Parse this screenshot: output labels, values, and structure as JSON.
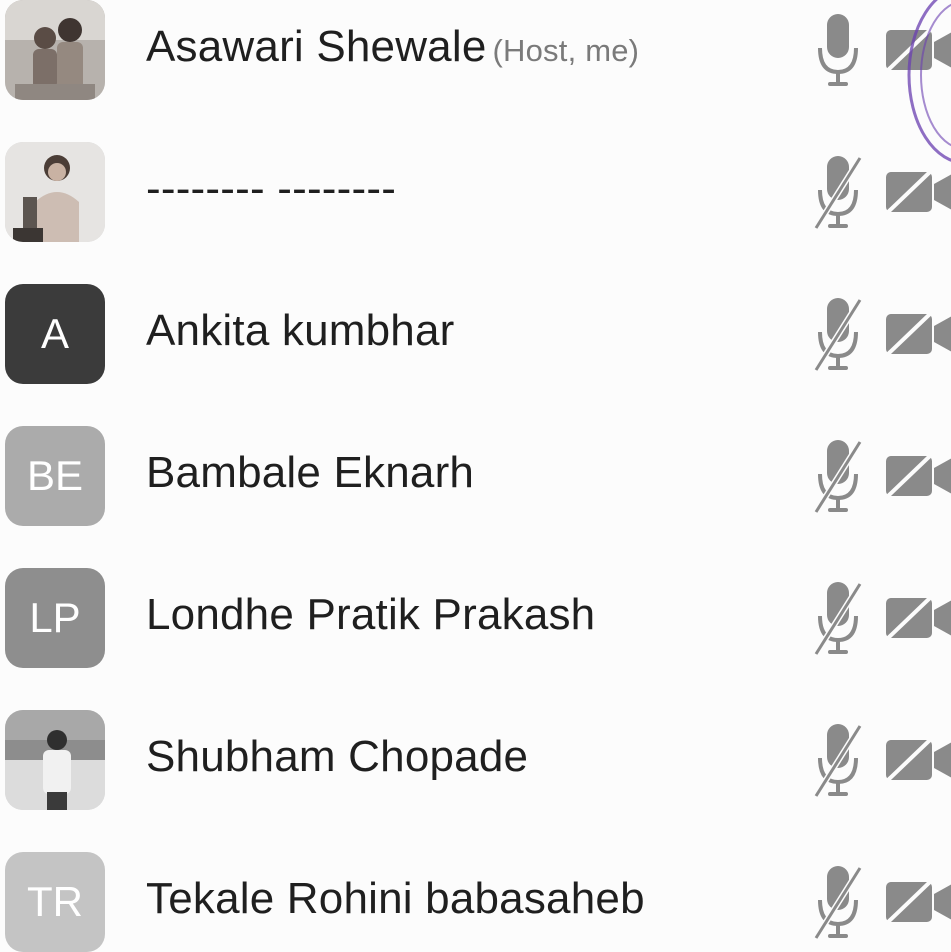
{
  "participants": [
    {
      "name": "Asawari Shewale",
      "role": "(Host, me)",
      "avatar_type": "photo",
      "avatar_initials": "",
      "mic": "on",
      "video": "off"
    },
    {
      "name": "-------- --------",
      "role": "",
      "avatar_type": "photo",
      "avatar_initials": "",
      "mic": "muted",
      "video": "off"
    },
    {
      "name": "Ankita kumbhar",
      "role": "",
      "avatar_type": "initials",
      "avatar_initials": "A",
      "mic": "muted",
      "video": "off"
    },
    {
      "name": "Bambale Eknarh",
      "role": "",
      "avatar_type": "initials",
      "avatar_initials": "BE",
      "mic": "muted",
      "video": "off"
    },
    {
      "name": "Londhe Pratik Prakash",
      "role": "",
      "avatar_type": "initials",
      "avatar_initials": "LP",
      "mic": "muted",
      "video": "off"
    },
    {
      "name": "Shubham Chopade",
      "role": "",
      "avatar_type": "photo",
      "avatar_initials": "",
      "mic": "muted",
      "video": "off"
    },
    {
      "name": "Tekale Rohini babasaheb",
      "role": "",
      "avatar_type": "initials",
      "avatar_initials": "TR",
      "mic": "muted",
      "video": "off"
    }
  ],
  "icons": {
    "mic_on": "microphone-icon",
    "mic_muted": "microphone-muted-icon",
    "video_off": "video-off-icon"
  },
  "colors": {
    "text": "#1f1f1f",
    "role_text": "#7a7a7a",
    "icon_gray": "#8a8a8a",
    "stamp": "#6a3fb0"
  }
}
